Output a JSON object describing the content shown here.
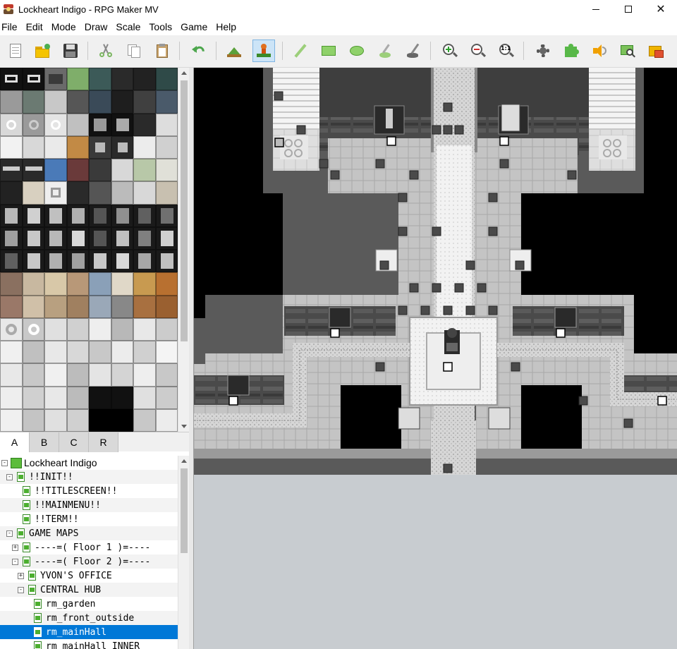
{
  "window": {
    "title": "Lockheart Indigo - RPG Maker MV"
  },
  "menu": [
    "File",
    "Edit",
    "Mode",
    "Draw",
    "Scale",
    "Tools",
    "Game",
    "Help"
  ],
  "toolbar": {
    "buttons": [
      "new-project",
      "open-project",
      "save-project",
      "cut",
      "copy",
      "paste",
      "undo",
      "map-mode",
      "event-mode",
      "pencil",
      "rectangle",
      "ellipse",
      "flood-fill",
      "shadow-pen",
      "zoom-in",
      "zoom-out",
      "actual-size",
      "database",
      "plugin-manager",
      "sound-test",
      "event-searcher",
      "resource-manager"
    ],
    "actual_size_label": "1:1",
    "active": "event-mode"
  },
  "tileset_tabs": [
    "A",
    "B",
    "C",
    "R"
  ],
  "tileset_active_tab": "A",
  "tree": {
    "project": "Lockheart Indigo",
    "items": [
      {
        "label": "!!INIT!!",
        "level": 1,
        "toggle": "-"
      },
      {
        "label": "!!TITLESCREEN!!",
        "level": 2,
        "toggle": ""
      },
      {
        "label": "!!MAINMENU!!",
        "level": 2,
        "toggle": ""
      },
      {
        "label": "!!TERM!!",
        "level": 2,
        "toggle": ""
      },
      {
        "label": "GAME MAPS",
        "level": 1,
        "toggle": "-"
      },
      {
        "label": "----=( Floor 1 )=----",
        "level": 2,
        "toggle": "+"
      },
      {
        "label": "----=( Floor 2 )=----",
        "level": 2,
        "toggle": "-"
      },
      {
        "label": "YVON'S OFFICE",
        "level": 3,
        "toggle": "+"
      },
      {
        "label": "CENTRAL HUB",
        "level": 3,
        "toggle": "-"
      },
      {
        "label": "rm_garden",
        "level": 4,
        "toggle": ""
      },
      {
        "label": "rm_front_outside",
        "level": 4,
        "toggle": ""
      },
      {
        "label": "rm_mainHall",
        "level": 4,
        "toggle": "",
        "selected": true
      },
      {
        "label": "rm_mainHall_INNER",
        "level": 4,
        "toggle": ""
      }
    ]
  },
  "colors": {
    "selection": "#0078d7",
    "map_void": "#000000",
    "map_background": "#c8ccd0",
    "floor_light": "#c4c4c4",
    "wall_dark": "#4a4a4a"
  }
}
